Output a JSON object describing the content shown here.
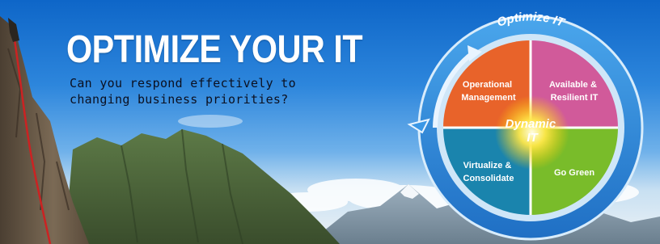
{
  "banner": {
    "headline": "OPTIMIZE YOUR IT",
    "subline_lines": [
      "Can you respond effectively to",
      "changing business priorities?"
    ]
  },
  "diagram": {
    "ring_title": "Optimize IT",
    "center_lines": [
      "Dynamic",
      "IT"
    ],
    "quadrants": [
      {
        "lines": [
          "Operational",
          "Management"
        ],
        "color": "#e8632a"
      },
      {
        "lines": [
          "Available &",
          "Resilient IT"
        ],
        "color": "#d15a9a"
      },
      {
        "lines": [
          "Virtualize &",
          "Consolidate"
        ],
        "color": "#1a84ad"
      },
      {
        "lines": [
          "Go Green"
        ],
        "color": "#79bc2a"
      }
    ]
  },
  "colors": {
    "sky_top": "#0e66c8",
    "ring_blue": "#2f8fe0",
    "ring_inner": "#cfe6f8",
    "mountain_green": "#4f6a3c",
    "cliff_brown": "#6e5a44",
    "rope_red": "#cc2222"
  }
}
